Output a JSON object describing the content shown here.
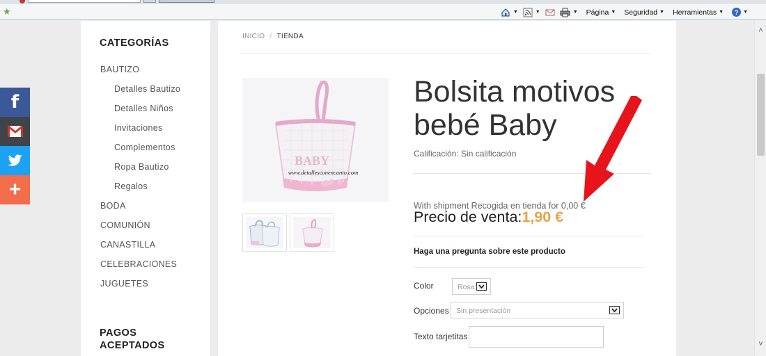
{
  "browser": {
    "cmd_labels": {
      "page": "Página",
      "security": "Seguridad",
      "tools": "Herramientas"
    },
    "help_glyph": "?"
  },
  "social": {
    "facebook_glyph": "f",
    "plus_glyph": "+",
    "colors": {
      "facebook": "#3b5998",
      "gmail": "#3f4449",
      "twitter": "#1da1f2",
      "share": "#f26e4b"
    }
  },
  "sidebar": {
    "categories_title": "CATEGORÍAS",
    "categories": [
      {
        "label": "BAUTIZO"
      },
      {
        "label": "Detalles Bautizo"
      },
      {
        "label": "Detalles Niños"
      },
      {
        "label": "Invitaciones"
      },
      {
        "label": "Complementos"
      },
      {
        "label": "Ropa Bautizo"
      },
      {
        "label": "Regalos"
      },
      {
        "label": "BODA"
      },
      {
        "label": "COMUNIÓN"
      },
      {
        "label": "CANASTILLA"
      },
      {
        "label": "CELEBRACIONES"
      },
      {
        "label": "JUGUETES"
      }
    ],
    "payments_title": "PAGOS ACEPTADOS"
  },
  "breadcrumb": {
    "home": "INICIO",
    "separator": "/",
    "current": "TIENDA"
  },
  "product": {
    "title": "Bolsita motivos bebé Baby",
    "image_watermark": "www.detallesconencanto.com",
    "image_text": "BABY",
    "rating": "Calificación: Sin calificación",
    "shipment": "With shipment Recogida en tienda for 0,00 €",
    "price_label": "Precio de venta:",
    "price": "1,90 €",
    "question_link": "Haga una pregunta sobre este producto",
    "price_color": "#e3a44a"
  },
  "options": {
    "color_label": "Color",
    "color_value": "Rosa",
    "opciones_label": "Opciones",
    "opciones_value": "Sin presentación",
    "texto_label": "Texto tarjetitas",
    "texto_value": ""
  }
}
